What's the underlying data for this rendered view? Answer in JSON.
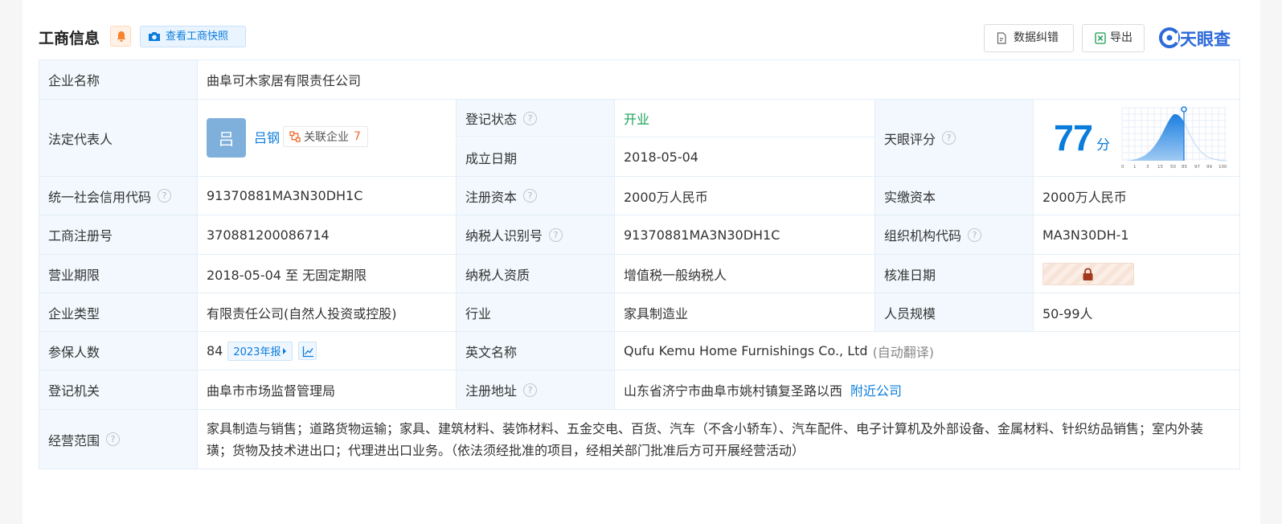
{
  "header": {
    "title": "工商信息",
    "snapshot_label": "查看工商快照",
    "correct_label": "数据纠错",
    "export_label": "导出",
    "logo_text": "天眼查",
    "accent_color": "#0a7cdc",
    "bell_color": "#f7842b"
  },
  "company_name": {
    "label": "企业名称",
    "value": "曲阜可木家居有限责任公司"
  },
  "legal_rep": {
    "label": "法定代表人",
    "avatar_char": "吕",
    "name": "吕钢",
    "related_label": "关联企业",
    "related_count": "7"
  },
  "reg_status": {
    "label": "登记状态",
    "value": "开业"
  },
  "found_date": {
    "label": "成立日期",
    "value": "2018-05-04"
  },
  "tianyan_score": {
    "label": "天眼评分",
    "value": "77",
    "unit": "分",
    "axis_ticks": [
      "0",
      "1",
      "3",
      "15",
      "50",
      "85",
      "97",
      "99",
      "100"
    ]
  },
  "credit_code": {
    "label": "统一社会信用代码",
    "value": "91370881MA3N30DH1C"
  },
  "reg_capital": {
    "label": "注册资本",
    "value": "2000万人民币"
  },
  "paid_capital": {
    "label": "实缴资本",
    "value": "2000万人民币"
  },
  "biz_reg_no": {
    "label": "工商注册号",
    "value": "370881200086714"
  },
  "taxpayer_id": {
    "label": "纳税人识别号",
    "value": "91370881MA3N30DH1C"
  },
  "org_code": {
    "label": "组织机构代码",
    "value": "MA3N30DH-1"
  },
  "biz_term": {
    "label": "营业期限",
    "value": "2018-05-04 至 无固定期限"
  },
  "taxpayer_qual": {
    "label": "纳税人资质",
    "value": "增值税一般纳税人"
  },
  "approve_date": {
    "label": "核准日期"
  },
  "company_type": {
    "label": "企业类型",
    "value": "有限责任公司(自然人投资或控股)"
  },
  "industry": {
    "label": "行业",
    "value": "家具制造业"
  },
  "staff_size": {
    "label": "人员规模",
    "value": "50-99人"
  },
  "insured": {
    "label": "参保人数",
    "value": "84",
    "report_label": "2023年报"
  },
  "english_name": {
    "label": "英文名称",
    "value": "Qufu Kemu Home Furnishings Co., Ltd",
    "note": "(自动翻译)"
  },
  "reg_authority": {
    "label": "登记机关",
    "value": "曲阜市市场监督管理局"
  },
  "reg_address": {
    "label": "注册地址",
    "value": "山东省济宁市曲阜市姚村镇复圣路以西",
    "nearby_label": "附近公司"
  },
  "biz_scope": {
    "label": "经营范围",
    "value": "家具制造与销售；道路货物运输；家具、建筑材料、装饰材料、五金交电、百货、汽车（不含小轿车）、汽车配件、电子计算机及外部设备、金属材料、针织纺品销售；室内外装璜；货物及技术进出口；代理进出口业务。（依法须经批准的项目，经相关部门批准后方可开展经营活动）"
  }
}
